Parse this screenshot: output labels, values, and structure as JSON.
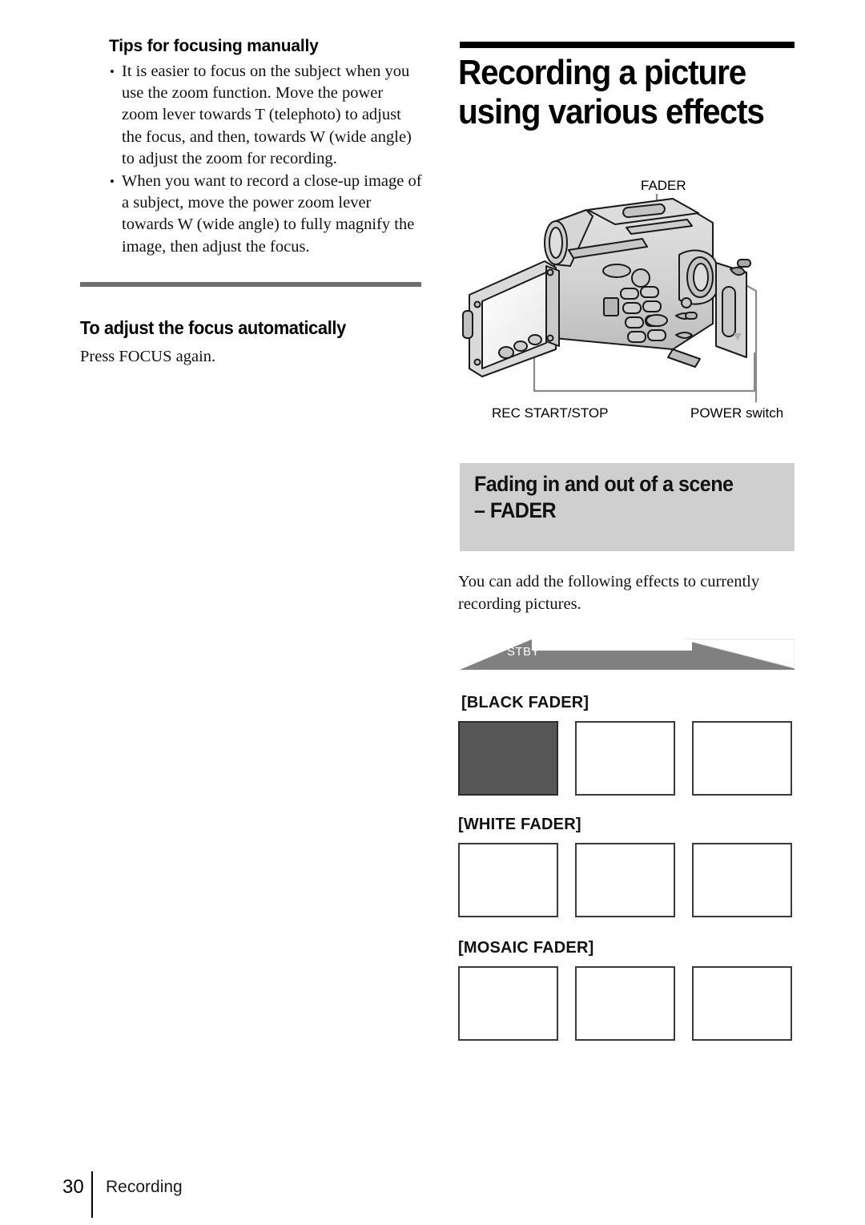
{
  "left_column": {
    "tips_title": "Tips for focusing manually",
    "bullets": [
      "It is easier to focus on the subject when you use the zoom function. Move the power zoom lever towards T (telephoto) to adjust the focus, and then, towards W (wide angle) to adjust the zoom for recording.",
      "When you want to record a close-up image of a subject, move the power zoom lever towards W (wide angle) to fully magnify the image, then adjust the focus."
    ],
    "subsection_heading": "To adjust the focus automatically",
    "subsection_body": "Press FOCUS again."
  },
  "right_column": {
    "chapter_title": "Recording a picture using various effects",
    "figure_labels": {
      "fader": "FADER",
      "rec_start_stop": "REC START/STOP",
      "power_switch": "POWER switch"
    },
    "section_band_heading": "Fading in and out of a scene\n– FADER",
    "section_body": "You can add the following effects to currently recording pictures.",
    "standby_label": "STBY",
    "fader_groups": [
      {
        "label": "[BLACK FADER]",
        "frames": [
          "dark",
          "white",
          "white"
        ]
      },
      {
        "label": "[WHITE FADER]",
        "frames": [
          "white",
          "white",
          "white"
        ]
      },
      {
        "label": "[MOSAIC FADER]",
        "frames": [
          "white",
          "white",
          "white"
        ]
      }
    ]
  },
  "footer": {
    "page_number": "30",
    "section_name": "Recording"
  },
  "colors": {
    "band_gray": "#cfcfcf",
    "rule_gray": "#6f6f6f",
    "rule_black": "#000000",
    "dark_frame": "#575757",
    "stby_gray": "#808080",
    "body_text": "#111111"
  }
}
